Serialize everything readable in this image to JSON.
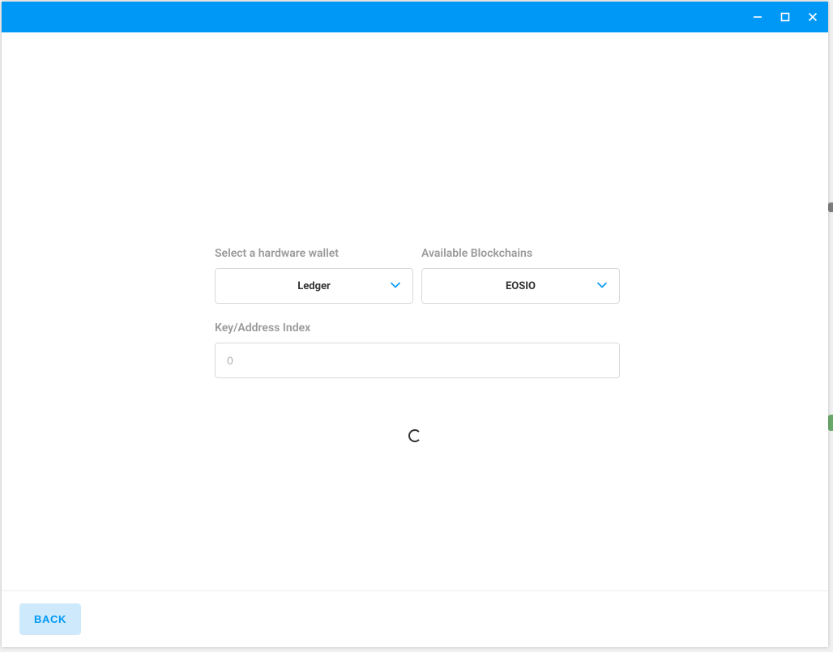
{
  "colors": {
    "accent": "#0098f7",
    "label": "#9a9a9a",
    "border": "#d9d9d9",
    "back_button_bg": "#cde9fb"
  },
  "form": {
    "hardware_wallet": {
      "label": "Select a hardware wallet",
      "selected": "Ledger"
    },
    "blockchain": {
      "label": "Available Blockchains",
      "selected": "EOSIO"
    },
    "key_index": {
      "label": "Key/Address Index",
      "placeholder": "0",
      "value": ""
    }
  },
  "footer": {
    "back_label": "BACK"
  }
}
